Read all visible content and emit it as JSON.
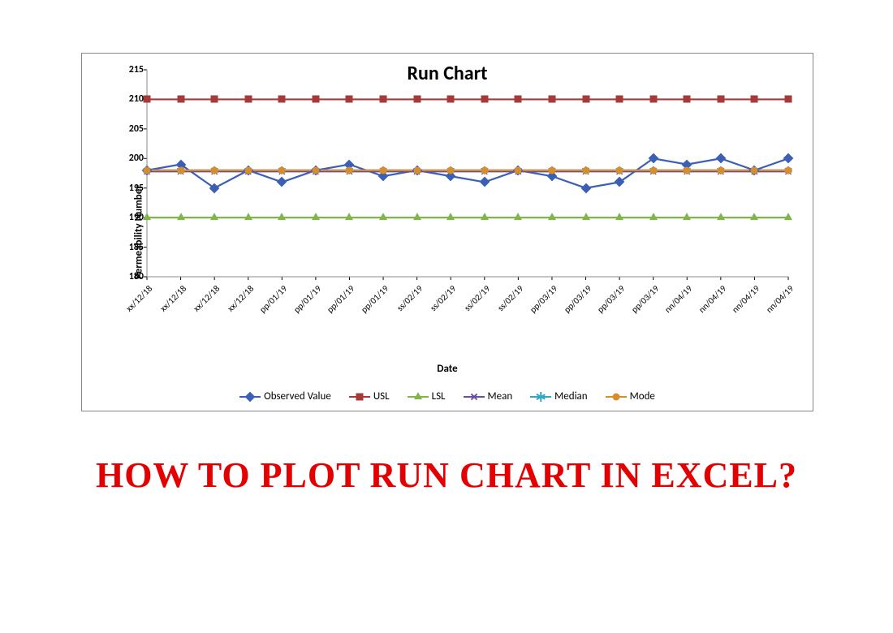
{
  "chart_data": {
    "type": "line",
    "title": "Run Chart",
    "xlabel": "Date",
    "ylabel": "Permeability Number",
    "ylim": [
      180,
      215
    ],
    "yticks": [
      180,
      185,
      190,
      195,
      200,
      205,
      210,
      215
    ],
    "categories": [
      "xx/12/18",
      "xx/12/18",
      "xx/12/18",
      "xx/12/18",
      "pp/01/19",
      "pp/01/19",
      "pp/01/19",
      "pp/01/19",
      "ss/02/19",
      "ss/02/19",
      "ss/02/19",
      "ss/02/19",
      "pp/03/19",
      "pp/03/19",
      "pp/03/19",
      "pp/03/19",
      "nn/04/19",
      "nn/04/19",
      "nn/04/19",
      "nn/04/19"
    ],
    "series": [
      {
        "name": "Observed Value",
        "color": "#3a5fb5",
        "marker": "diamond",
        "values": [
          198,
          199,
          195,
          198,
          196,
          198,
          199,
          197,
          198,
          197,
          196,
          198,
          197,
          195,
          196,
          200,
          199,
          200,
          198,
          200
        ]
      },
      {
        "name": "USL",
        "color": "#a43a3a",
        "marker": "square",
        "values": [
          210,
          210,
          210,
          210,
          210,
          210,
          210,
          210,
          210,
          210,
          210,
          210,
          210,
          210,
          210,
          210,
          210,
          210,
          210,
          210
        ]
      },
      {
        "name": "LSL",
        "color": "#7fb54b",
        "marker": "triangle",
        "values": [
          190,
          190,
          190,
          190,
          190,
          190,
          190,
          190,
          190,
          190,
          190,
          190,
          190,
          190,
          190,
          190,
          190,
          190,
          190,
          190
        ]
      },
      {
        "name": "Mean",
        "color": "#6b4f9b",
        "marker": "xmark",
        "values": [
          197.8,
          197.8,
          197.8,
          197.8,
          197.8,
          197.8,
          197.8,
          197.8,
          197.8,
          197.8,
          197.8,
          197.8,
          197.8,
          197.8,
          197.8,
          197.8,
          197.8,
          197.8,
          197.8,
          197.8
        ]
      },
      {
        "name": "Median",
        "color": "#31a5c2",
        "marker": "star",
        "values": [
          198,
          198,
          198,
          198,
          198,
          198,
          198,
          198,
          198,
          198,
          198,
          198,
          198,
          198,
          198,
          198,
          198,
          198,
          198,
          198
        ]
      },
      {
        "name": "Mode",
        "color": "#d98c2b",
        "marker": "circle",
        "values": [
          198,
          198,
          198,
          198,
          198,
          198,
          198,
          198,
          198,
          198,
          198,
          198,
          198,
          198,
          198,
          198,
          198,
          198,
          198,
          198
        ]
      }
    ]
  },
  "caption": "How to plot Run chart in excel?"
}
